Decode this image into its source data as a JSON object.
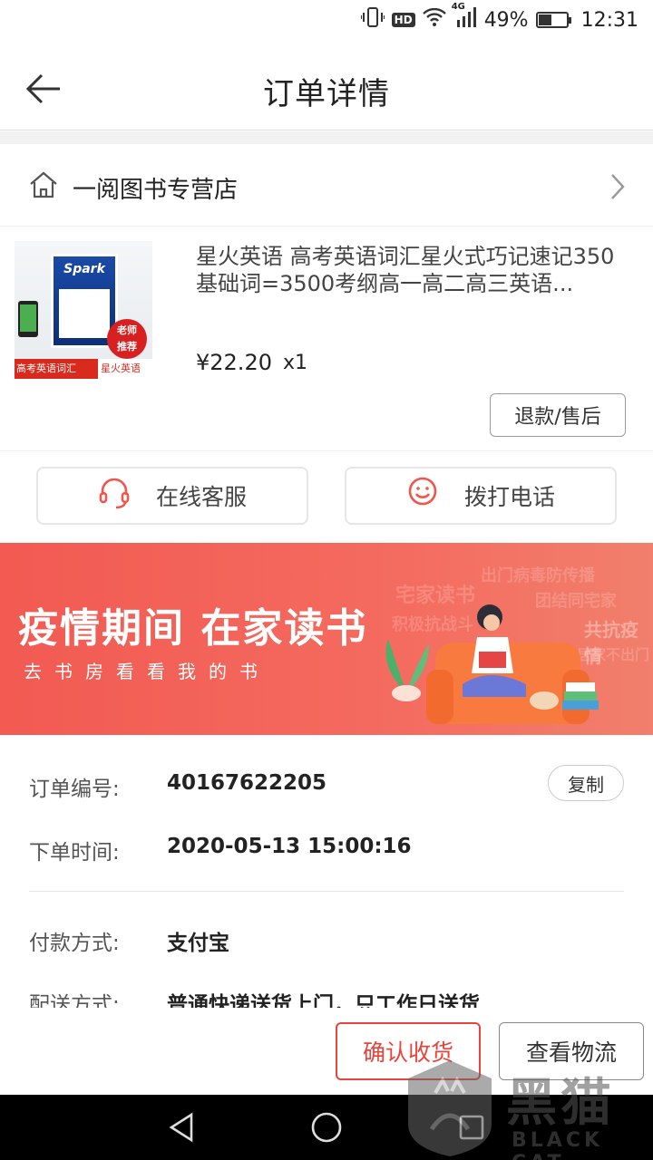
{
  "status_bar": {
    "hd": "HD",
    "network": "4G",
    "battery": "49%",
    "battery_level": 0.49,
    "time": "12:31"
  },
  "header": {
    "title": "订单详情"
  },
  "store": {
    "name": "一阅图书专营店"
  },
  "product": {
    "title": "星火英语 高考英语词汇星火式巧记速记350基础词=3500考纲高一高二高三英语...",
    "price": "¥22.20",
    "quantity": "x1",
    "refund_label": "退款/售后",
    "thumb": {
      "brand": "Spark",
      "badge_line1": "老师",
      "badge_line2": "推荐",
      "strip_left": "高考英语词汇",
      "strip_right": "星火英语"
    }
  },
  "service": {
    "online_label": "在线客服",
    "phone_label": "拨打电话"
  },
  "banner": {
    "main": "疫情期间 在家读书",
    "sub": "去书房看看我的书",
    "bg_words": [
      "宅家读书",
      "出门病毒防传播",
      "团结同宅家",
      "共抗疫情",
      "积极抗战斗",
      "居家不出门"
    ]
  },
  "order": {
    "number_label": "订单编号:",
    "number": "40167622205",
    "copy_label": "复制",
    "time_label": "下单时间:",
    "time": "2020-05-13 15:00:16",
    "payment_label": "付款方式:",
    "payment": "支付宝",
    "delivery_label": "配送方式:",
    "delivery": "普通快递送货上门，只工作日送货"
  },
  "actions": {
    "confirm_label": "确认收货",
    "logistics_label": "查看物流"
  },
  "watermark": {
    "text": "黑猫",
    "sub": "BLACK CAT"
  },
  "colors": {
    "accent": "#e8443a",
    "banner": "#f25a52"
  }
}
